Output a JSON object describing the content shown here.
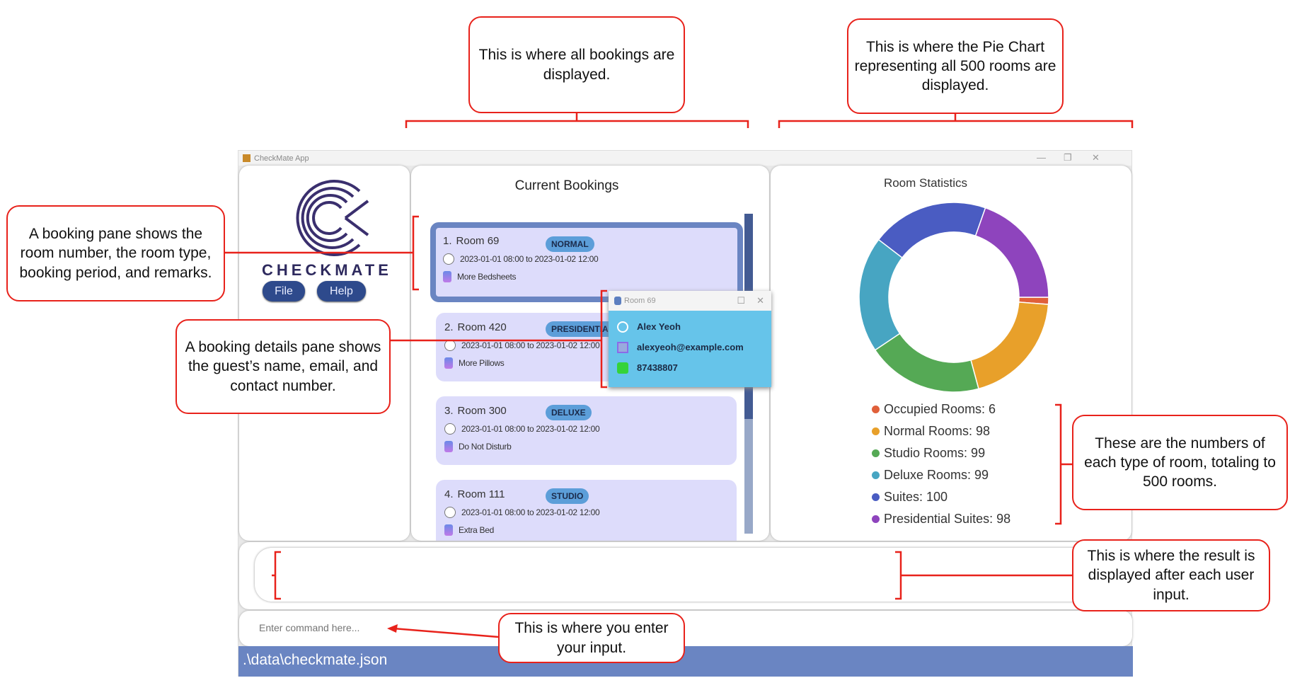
{
  "window": {
    "title": "CheckMate App",
    "controls": [
      "—",
      "❐",
      "✕"
    ]
  },
  "sidebar": {
    "logo_text": "CHECKMATE",
    "file_label": "File",
    "help_label": "Help"
  },
  "bookings": {
    "title": "Current Bookings",
    "items": [
      {
        "index": "1.",
        "room": "Room 69",
        "type": "NORMAL",
        "period": "2023-01-01 08:00 to 2023-01-02 12:00",
        "remark": "More Bedsheets"
      },
      {
        "index": "2.",
        "room": "Room 420",
        "type": "PRESIDENTIAL",
        "period": "2023-01-01 08:00 to 2023-01-02 12:00",
        "remark": "More Pillows"
      },
      {
        "index": "3.",
        "room": "Room 300",
        "type": "DELUXE",
        "period": "2023-01-01 08:00 to 2023-01-02 12:00",
        "remark": "Do Not Disturb"
      },
      {
        "index": "4.",
        "room": "Room 111",
        "type": "STUDIO",
        "period": "2023-01-01 08:00 to 2023-01-02 12:00",
        "remark": "Extra Bed"
      }
    ]
  },
  "details_popup": {
    "title": "Room 69",
    "name": "Alex Yeoh",
    "email": "alexyeoh@example.com",
    "phone": "87438807"
  },
  "chart_data": {
    "type": "pie",
    "title": "Room Statistics",
    "donut": true,
    "categories": [
      "Occupied Rooms",
      "Normal Rooms",
      "Studio Rooms",
      "Deluxe Rooms",
      "Suites",
      "Presidential Suites"
    ],
    "values": [
      6,
      98,
      99,
      99,
      100,
      98
    ],
    "colors": [
      "#e0603a",
      "#e8a02a",
      "#55a955",
      "#47a5c2",
      "#4a5cc2",
      "#8e44bd"
    ],
    "legend_labels": [
      "Occupied Rooms: 6",
      "Normal Rooms: 98",
      "Studio Rooms: 99",
      "Deluxe Rooms: 99",
      "Suites: 100",
      "Presidential Suites: 98"
    ],
    "legend_position": "bottom"
  },
  "command": {
    "placeholder": "Enter command here..."
  },
  "status_bar": {
    "path": ".\\data\\checkmate.json"
  },
  "annotations": {
    "bookings": "This is where all bookings are displayed.",
    "pie": "This is where the Pie Chart representing all 500 rooms are displayed.",
    "booking_pane": "A booking pane shows the room number, the room type, booking period, and remarks.",
    "details_pane": "A booking details pane shows the guest’s name, email, and contact number.",
    "numbers": "These are the numbers of each type of room, totaling to 500 rooms.",
    "result": "This is where the result is displayed after each user input.",
    "input": "This is where you enter your input."
  },
  "colors": {
    "accent": "#6a85c2",
    "annotation": "#e8221b",
    "card": "#dddcfb",
    "popup": "#66c4ea"
  }
}
